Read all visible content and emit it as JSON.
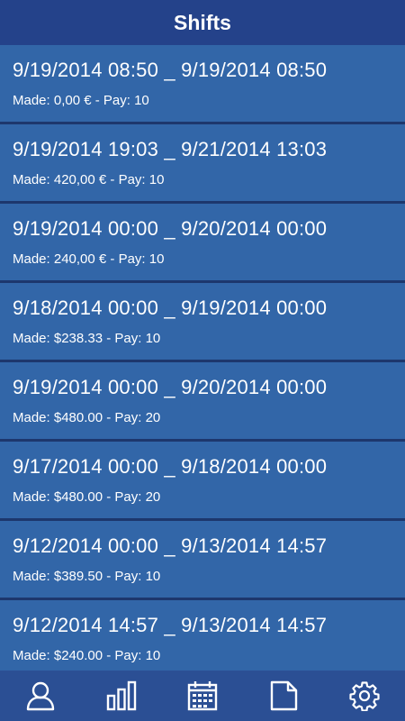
{
  "header": {
    "title": "Shifts"
  },
  "shifts": [
    {
      "range": "9/19/2014 08:50 _ 9/19/2014 08:50",
      "summary": "Made: 0,00 € - Pay: 10"
    },
    {
      "range": "9/19/2014 19:03 _ 9/21/2014 13:03",
      "summary": "Made: 420,00 € - Pay: 10"
    },
    {
      "range": "9/19/2014 00:00 _ 9/20/2014 00:00",
      "summary": "Made: 240,00 € - Pay: 10"
    },
    {
      "range": "9/18/2014 00:00 _ 9/19/2014 00:00",
      "summary": "Made: $238.33 - Pay: 10"
    },
    {
      "range": "9/19/2014 00:00 _ 9/20/2014 00:00",
      "summary": "Made: $480.00 - Pay: 20"
    },
    {
      "range": "9/17/2014 00:00 _ 9/18/2014 00:00",
      "summary": "Made: $480.00 - Pay: 20"
    },
    {
      "range": "9/12/2014 00:00 _ 9/13/2014 14:57",
      "summary": "Made: $389.50 - Pay: 10"
    },
    {
      "range": "9/12/2014 14:57 _ 9/13/2014 14:57",
      "summary": "Made: $240.00 - Pay: 10"
    }
  ],
  "tabbar": [
    {
      "icon": "user-icon"
    },
    {
      "icon": "bar-chart-icon"
    },
    {
      "icon": "calendar-icon"
    },
    {
      "icon": "document-icon"
    },
    {
      "icon": "gear-icon"
    }
  ],
  "colors": {
    "header_bg": "#24428a",
    "item_bg": "#3266a8",
    "separator": "#1d376d",
    "tabbar_bg": "#2b4f94",
    "text": "#ffffff"
  }
}
